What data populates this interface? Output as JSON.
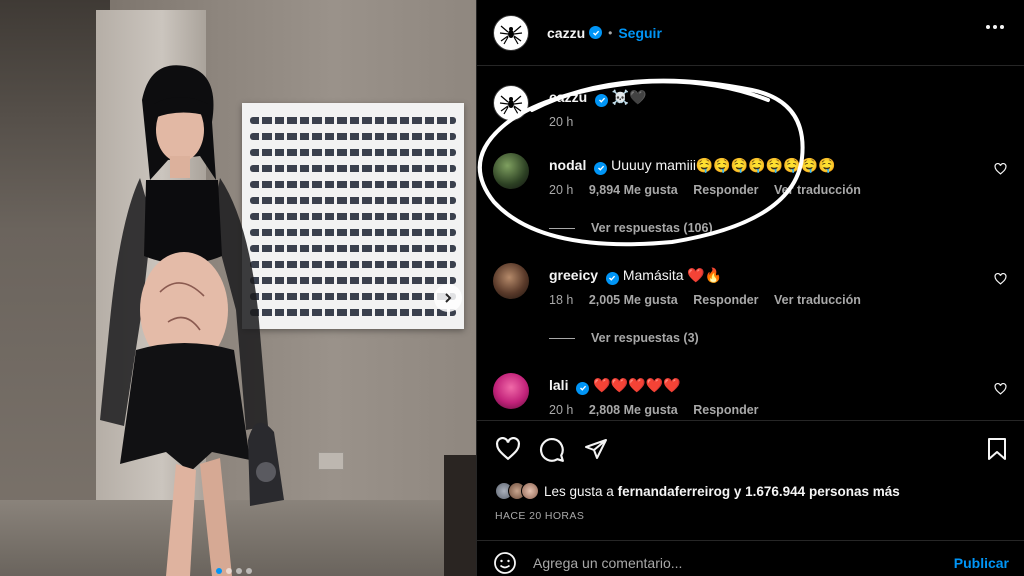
{
  "post": {
    "author": "cazzu",
    "follow_label": "Seguir",
    "separator": "•"
  },
  "caption": {
    "username": "cazzu",
    "emojis": "☠️🖤",
    "time": "20 h"
  },
  "comments": [
    {
      "username": "nodal",
      "verified": true,
      "text": "Uuuuy mamiii🤤🤤🤤🤤🤤🤤🤤🤤",
      "time": "20 h",
      "likes": "9,894 Me gusta",
      "reply": "Responder",
      "translate": "Ver traducción",
      "view_replies": "Ver respuestas (106)"
    },
    {
      "username": "greeicy",
      "verified": true,
      "text": "Mamásita ❤️🔥",
      "time": "18 h",
      "likes": "2,005 Me gusta",
      "reply": "Responder",
      "translate": "Ver traducción",
      "view_replies": "Ver respuestas (3)"
    },
    {
      "username": "lali",
      "verified": true,
      "text": "❤️❤️❤️❤️❤️",
      "time": "20 h",
      "likes": "2,808 Me gusta",
      "reply": "Responder"
    }
  ],
  "likes_summary": {
    "prefix": "Les gusta a",
    "user": "fernandaferreirog",
    "suffix": "y 1.676.944 personas más"
  },
  "time_ago": "HACE 20 HORAS",
  "composer": {
    "placeholder": "Agrega un comentario...",
    "post_label": "Publicar"
  },
  "colors": {
    "accent": "#0095f6",
    "background": "#000000",
    "muted_text": "#a8a8a8",
    "annotation": "#ffffff"
  },
  "icons": [
    "spider-logo-icon",
    "verified-badge-icon",
    "more-options-icon",
    "heart-icon",
    "comment-icon",
    "share-icon",
    "bookmark-icon",
    "emoji-icon",
    "carousel-next-icon"
  ]
}
